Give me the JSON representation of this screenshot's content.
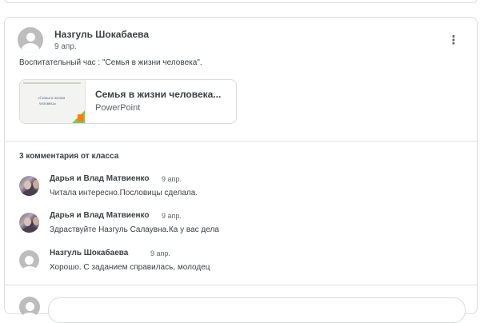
{
  "post": {
    "author": "Назгуль Шокабаева",
    "date": "9 апр.",
    "text": "Воспитательный час : \"Семья в жизни человека\".",
    "menu_icon": "more-vert-icon",
    "attachment": {
      "title": "Семья в жизни человека...",
      "type": "PowerPoint",
      "thumbnail_line1": "«Семья в жизни",
      "thumbnail_line2": "человека»"
    }
  },
  "comments": {
    "header": "3 комментария от класса",
    "items": [
      {
        "author": "Дарья и Влад Матвиенко",
        "date": "9 апр.",
        "text": "Читала интересно.Пословицы сделала.",
        "avatar": "photo"
      },
      {
        "author": "Дарья и Влад Матвиенко",
        "date": "9 апр.",
        "text": "Здраствуйте Назгуль Салаувна.Ка у вас дела",
        "avatar": "photo"
      },
      {
        "author": "Назгуль Шокабаева",
        "date": "9 апр.",
        "text": "Хорошо. С заданием справилась, молодец",
        "avatar": "generic"
      }
    ]
  },
  "colors": {
    "border": "#dadce0",
    "text": "#3c4043",
    "secondary": "#5f6368"
  }
}
